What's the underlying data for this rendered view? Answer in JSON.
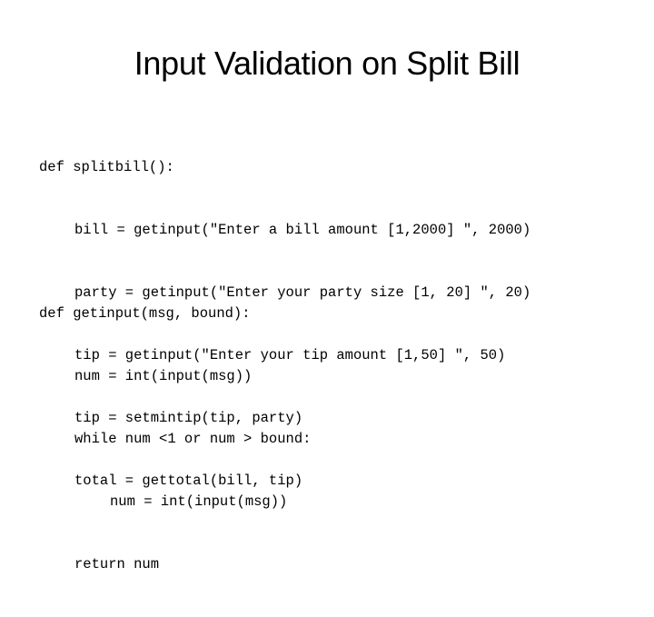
{
  "slide": {
    "title": "Input Validation on Split Bill",
    "code_blocks": [
      {
        "lines": [
          {
            "indent": 0,
            "text": "def splitbill():"
          },
          {
            "indent": 1,
            "text": "bill = getinput(\"Enter a bill amount [1,2000] \", 2000)"
          },
          {
            "indent": 1,
            "text": "party = getinput(\"Enter your party size [1, 20] \", 20)"
          },
          {
            "indent": 1,
            "text": "tip = getinput(\"Enter your tip amount [1,50] \", 50)"
          },
          {
            "indent": 1,
            "text": "tip = setmintip(tip, party)"
          },
          {
            "indent": 1,
            "text": "total = gettotal(bill, tip)"
          }
        ]
      },
      {
        "lines": [
          {
            "indent": 0,
            "text": "def getinput(msg, bound):"
          },
          {
            "indent": 1,
            "text": "num = int(input(msg))"
          },
          {
            "indent": 1,
            "text": "while num <1 or num > bound:"
          },
          {
            "indent": 2,
            "text": "num = int(input(msg))"
          },
          {
            "indent": 1,
            "text": "return num"
          }
        ]
      }
    ]
  }
}
